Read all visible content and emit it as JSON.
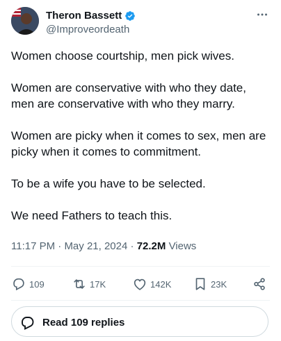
{
  "author": {
    "name": "Theron Bassett",
    "handle": "@Improveordeath"
  },
  "tweet": {
    "paragraphs": [
      "Women choose courtship, men pick wives.",
      "Women are conservative with who they date, men are conservative with who they marry.",
      "Women are picky when it comes to sex, men are picky when it comes to commitment.",
      "To be a wife you have to be selected.",
      "We need Fathers to teach this."
    ]
  },
  "meta": {
    "time": "11:17 PM",
    "date": "May 21, 2024",
    "views_count": "72.2M",
    "views_label": "Views"
  },
  "actions": {
    "replies": "109",
    "reposts": "17K",
    "likes": "142K",
    "bookmarks": "23K"
  },
  "replies_button": {
    "label": "Read 109 replies"
  },
  "colors": {
    "verified": "#1d9bf0",
    "text": "#0f1419",
    "secondary": "#536471"
  },
  "icons": [
    "verified-badge-icon",
    "more-icon",
    "reply-icon",
    "repost-icon",
    "like-icon",
    "bookmark-icon",
    "share-icon",
    "reply-bubble-icon"
  ]
}
